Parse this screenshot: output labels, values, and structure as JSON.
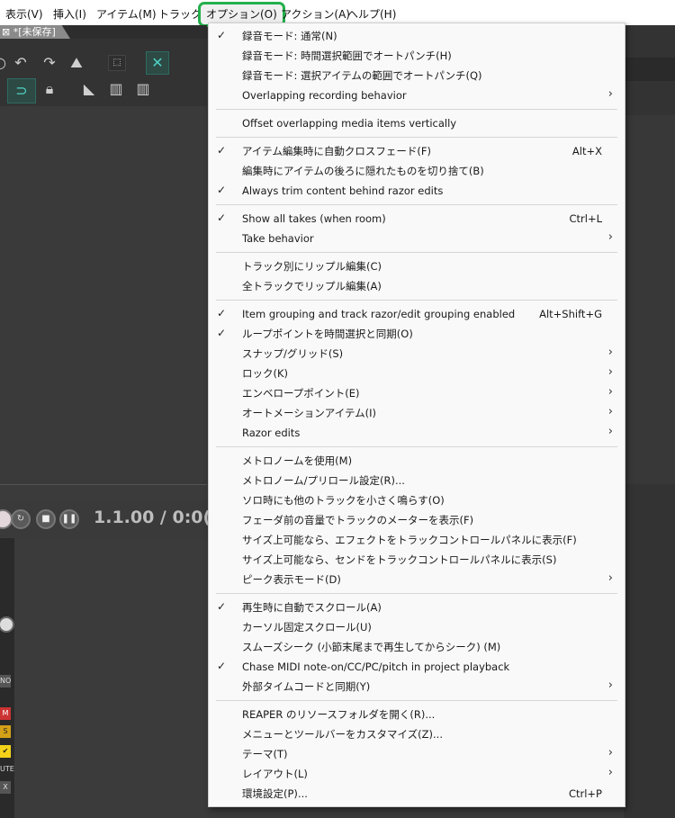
{
  "menubar": {
    "items": [
      "表示(V)",
      "挿入(I)",
      "アイテム(M)",
      "トラック(T",
      "オプション(O)",
      "アクション(A)",
      "ヘルプ(H)"
    ]
  },
  "project": {
    "tab_title": "*[未保存]",
    "tab_close": "⊠"
  },
  "transport": {
    "timecode": "1.1.00 / 0:0("
  },
  "mixer": {
    "labels": [
      "NO",
      "M",
      "S",
      "UTE",
      "X"
    ]
  },
  "options_menu": {
    "items": [
      {
        "label": "録音モード: 通常(N)",
        "checked": true,
        "shortcut": "",
        "submenu": false
      },
      {
        "label": "録音モード: 時間選択範囲でオートパンチ(H)",
        "checked": false,
        "shortcut": "",
        "submenu": false
      },
      {
        "label": "録音モード: 選択アイテムの範囲でオートパンチ(Q)",
        "checked": false,
        "shortcut": "",
        "submenu": false
      },
      {
        "label": "Overlapping recording behavior",
        "checked": false,
        "shortcut": "",
        "submenu": true
      },
      {
        "label": "Offset overlapping media items vertically",
        "checked": false,
        "shortcut": "",
        "submenu": false
      },
      {
        "label": "アイテム編集時に自動クロスフェード(F)",
        "checked": true,
        "shortcut": "Alt+X",
        "submenu": false
      },
      {
        "label": "編集時にアイテムの後ろに隠れたものを切り捨て(B)",
        "checked": false,
        "shortcut": "",
        "submenu": false
      },
      {
        "label": "Always trim content behind razor edits",
        "checked": true,
        "shortcut": "",
        "submenu": false
      },
      {
        "label": "Show all takes (when room)",
        "checked": true,
        "shortcut": "Ctrl+L",
        "submenu": false
      },
      {
        "label": "Take behavior",
        "checked": false,
        "shortcut": "",
        "submenu": true
      },
      {
        "label": "トラック別にリップル編集(C)",
        "checked": false,
        "shortcut": "",
        "submenu": false
      },
      {
        "label": "全トラックでリップル編集(A)",
        "checked": false,
        "shortcut": "",
        "submenu": false
      },
      {
        "label": "Item grouping and track razor/edit grouping enabled",
        "checked": true,
        "shortcut": "Alt+Shift+G",
        "submenu": false
      },
      {
        "label": "ループポイントを時間選択と同期(O)",
        "checked": true,
        "shortcut": "",
        "submenu": false
      },
      {
        "label": "スナップ/グリッド(S)",
        "checked": false,
        "shortcut": "",
        "submenu": true
      },
      {
        "label": "ロック(K)",
        "checked": false,
        "shortcut": "",
        "submenu": true
      },
      {
        "label": "エンベロープポイント(E)",
        "checked": false,
        "shortcut": "",
        "submenu": true
      },
      {
        "label": "オートメーションアイテム(I)",
        "checked": false,
        "shortcut": "",
        "submenu": true
      },
      {
        "label": "Razor edits",
        "checked": false,
        "shortcut": "",
        "submenu": true
      },
      {
        "label": "メトロノームを使用(M)",
        "checked": false,
        "shortcut": "",
        "submenu": false
      },
      {
        "label": "メトロノーム/プリロール設定(R)...",
        "checked": false,
        "shortcut": "",
        "submenu": false
      },
      {
        "label": "ソロ時にも他のトラックを小さく鳴らす(O)",
        "checked": false,
        "shortcut": "",
        "submenu": false
      },
      {
        "label": "フェーダ前の音量でトラックのメーターを表示(F)",
        "checked": false,
        "shortcut": "",
        "submenu": false
      },
      {
        "label": "サイズ上可能なら、エフェクトをトラックコントロールパネルに表示(F)",
        "checked": false,
        "shortcut": "",
        "submenu": false
      },
      {
        "label": "サイズ上可能なら、センドをトラックコントロールパネルに表示(S)",
        "checked": false,
        "shortcut": "",
        "submenu": false
      },
      {
        "label": "ピーク表示モード(D)",
        "checked": false,
        "shortcut": "",
        "submenu": true
      },
      {
        "label": "再生時に自動でスクロール(A)",
        "checked": true,
        "shortcut": "",
        "submenu": false
      },
      {
        "label": "カーソル固定スクロール(U)",
        "checked": false,
        "shortcut": "",
        "submenu": false
      },
      {
        "label": "スムーズシーク (小節末尾まで再生してからシーク) (M)",
        "checked": false,
        "shortcut": "",
        "submenu": false
      },
      {
        "label": "Chase MIDI note-on/CC/PC/pitch in project playback",
        "checked": true,
        "shortcut": "",
        "submenu": false
      },
      {
        "label": "外部タイムコードと同期(Y)",
        "checked": false,
        "shortcut": "",
        "submenu": true
      },
      {
        "label": "REAPER のリソースフォルダを開く(R)...",
        "checked": false,
        "shortcut": "",
        "submenu": false
      },
      {
        "label": "メニューとツールバーをカスタマイズ(Z)...",
        "checked": false,
        "shortcut": "",
        "submenu": false
      },
      {
        "label": "テーマ(T)",
        "checked": false,
        "shortcut": "",
        "submenu": true
      },
      {
        "label": "レイアウト(L)",
        "checked": false,
        "shortcut": "",
        "submenu": true
      },
      {
        "label": "環境設定(P)...",
        "checked": false,
        "shortcut": "Ctrl+P",
        "submenu": false
      }
    ]
  }
}
